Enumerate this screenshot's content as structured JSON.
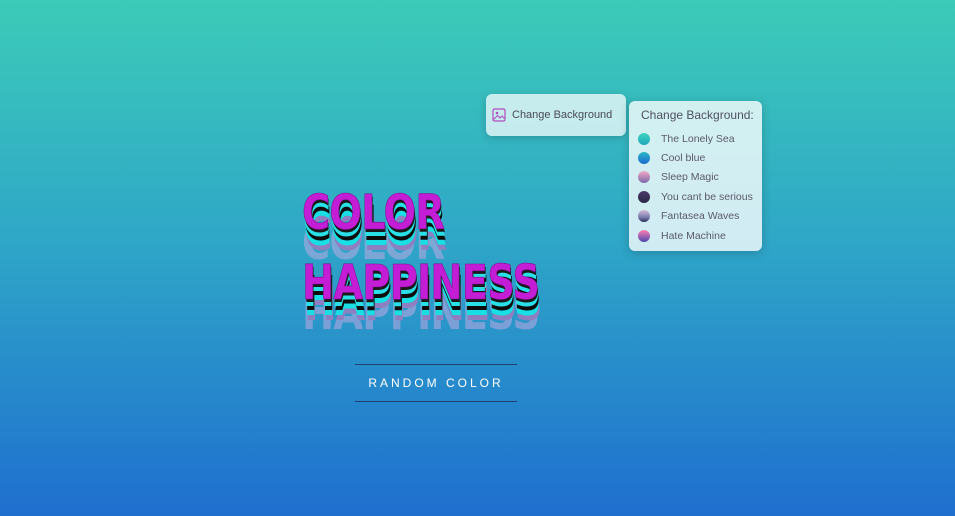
{
  "change_background_button": {
    "label": "Change Background",
    "icon": "image-icon"
  },
  "background_panel": {
    "title": "Change Background:",
    "options": [
      {
        "label": "The Lonely Sea"
      },
      {
        "label": "Cool blue"
      },
      {
        "label": "Sleep Magic"
      },
      {
        "label": "You cant be serious"
      },
      {
        "label": "Fantasea Waves"
      },
      {
        "label": "Hate Machine"
      }
    ]
  },
  "headline": {
    "line1": "COLOR",
    "line2": "HAPPINESS"
  },
  "random_button": {
    "label": "RANDOM COLOR"
  },
  "colors": {
    "background_top": "#3ccbb8",
    "background_bottom": "#1f6fcf",
    "headline_primary": "#c31ed6",
    "headline_cyan": "#29e0e6",
    "headline_shadow": "#1a1a1a"
  }
}
